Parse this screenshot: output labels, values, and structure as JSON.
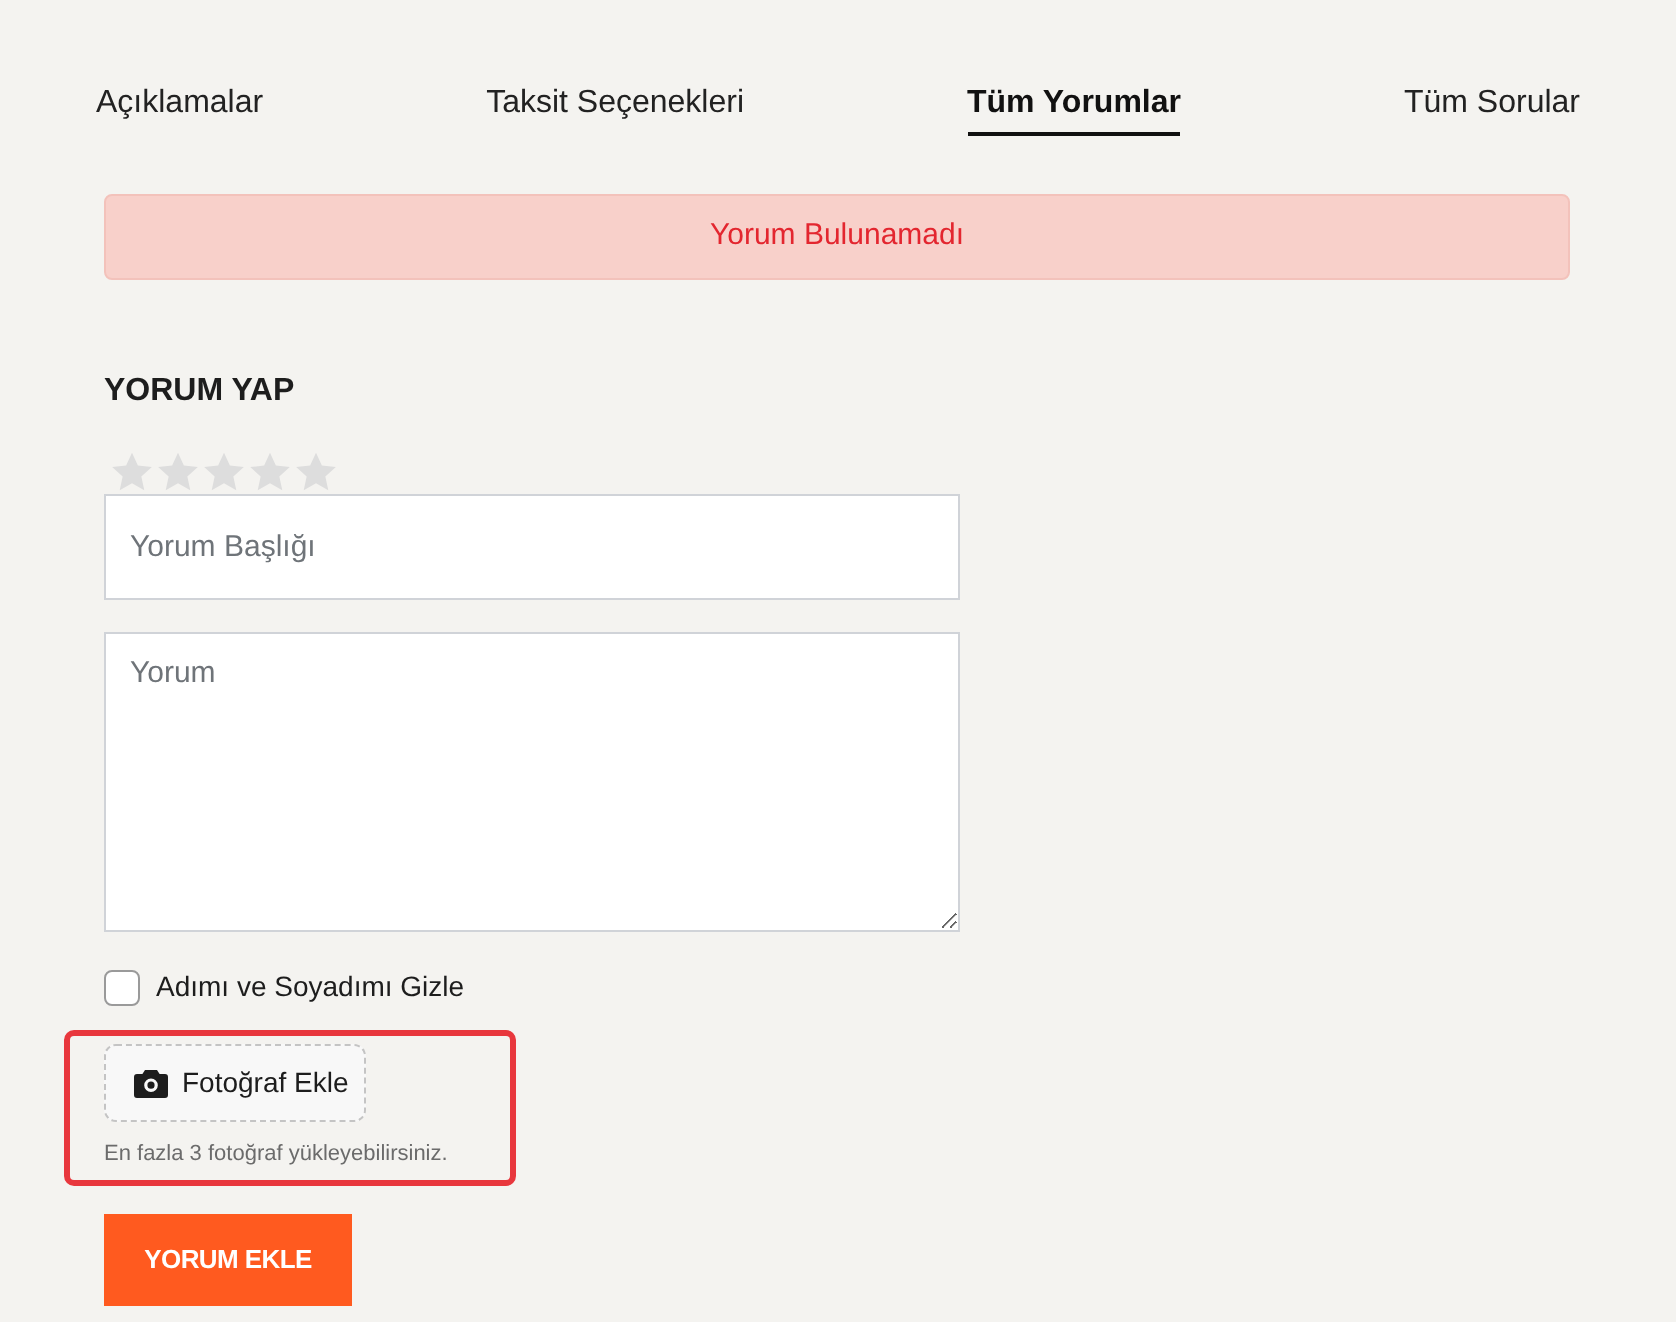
{
  "tabs": [
    {
      "label": "Açıklamalar",
      "selected": false
    },
    {
      "label": "Taksit Seçenekleri",
      "selected": false
    },
    {
      "label": "Tüm Yorumlar",
      "selected": true
    },
    {
      "label": "Tüm Sorular",
      "selected": false
    }
  ],
  "alert": {
    "text": "Yorum Bulunamadı"
  },
  "form": {
    "title": "YORUM YAP",
    "rating": {
      "stars": 0
    },
    "title_field": {
      "placeholder": "Yorum Başlığı"
    },
    "comment_field": {
      "placeholder": "Yorum"
    },
    "hide_name": {
      "label": "Adımı ve Soyadımı Gizle",
      "checked": false
    },
    "photo": {
      "button": "Fotoğraf Ekle",
      "hint": "En fazla 3 fotoğraf yükleyebilirsiniz.",
      "highlighted": true
    },
    "submit": "YORUM EKLE"
  }
}
